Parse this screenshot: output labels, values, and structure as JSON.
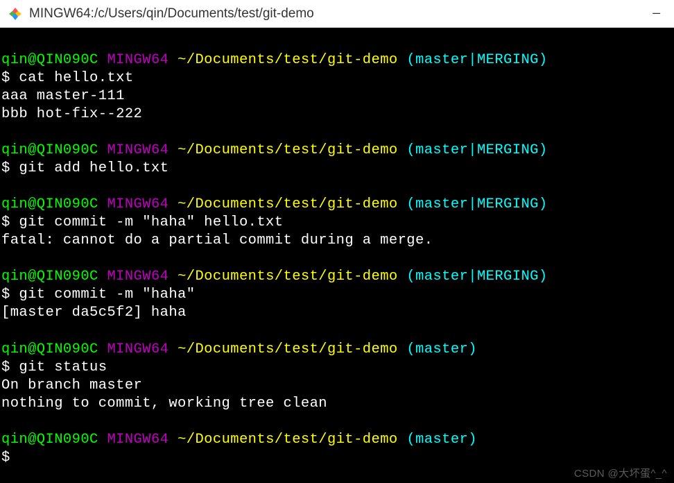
{
  "titlebar": {
    "title": "MINGW64:/c/Users/qin/Documents/test/git-demo"
  },
  "prompt": {
    "user": "qin@QIN090C",
    "mingw": "MINGW64",
    "path": "~/Documents/test/git-demo",
    "branch_merging": "(master|MERGING)",
    "branch_master": "(master)",
    "symbol": "$"
  },
  "blocks": [
    {
      "branch": "branch_merging",
      "command": "cat hello.txt",
      "output": [
        "aaa master-111",
        "bbb hot-fix--222"
      ]
    },
    {
      "branch": "branch_merging",
      "command": "git add hello.txt",
      "output": []
    },
    {
      "branch": "branch_merging",
      "command": "git commit -m \"haha\" hello.txt",
      "output": [
        "fatal: cannot do a partial commit during a merge."
      ]
    },
    {
      "branch": "branch_merging",
      "command": "git commit -m \"haha\"",
      "output": [
        "[master da5c5f2] haha"
      ]
    },
    {
      "branch": "branch_master",
      "command": "git status",
      "output": [
        "On branch master",
        "nothing to commit, working tree clean"
      ]
    },
    {
      "branch": "branch_master",
      "command": "",
      "output": []
    }
  ],
  "watermark": "CSDN @大坏蛋^_^"
}
